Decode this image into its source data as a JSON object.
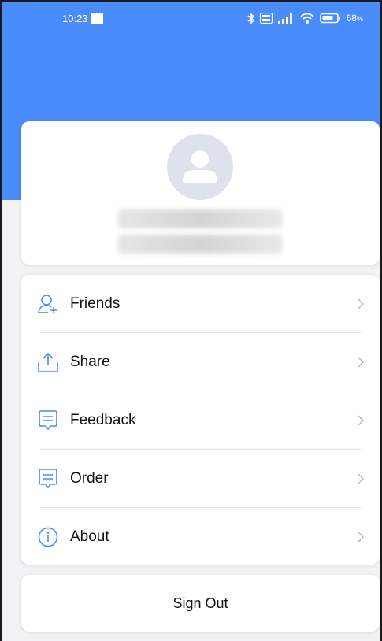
{
  "status_bar": {
    "time": "10:23",
    "battery_percent": "68",
    "battery_suffix": "%",
    "icons": [
      "bluetooth-icon",
      "volte-icon",
      "signal-icon",
      "wifi-icon",
      "battery-icon"
    ]
  },
  "theme": {
    "header_color": "#4a8cfb",
    "icon_color": "#4a8cfb",
    "background": "#f2f2f4"
  },
  "profile": {
    "avatar_icon": "user-avatar-icon"
  },
  "menu": {
    "items": [
      {
        "label": "Friends",
        "icon": "add-friend-icon"
      },
      {
        "label": "Share",
        "icon": "share-icon"
      },
      {
        "label": "Feedback",
        "icon": "feedback-icon"
      },
      {
        "label": "Order",
        "icon": "order-icon"
      },
      {
        "label": "About",
        "icon": "info-icon"
      }
    ]
  },
  "sign_out": {
    "label": "Sign Out"
  }
}
